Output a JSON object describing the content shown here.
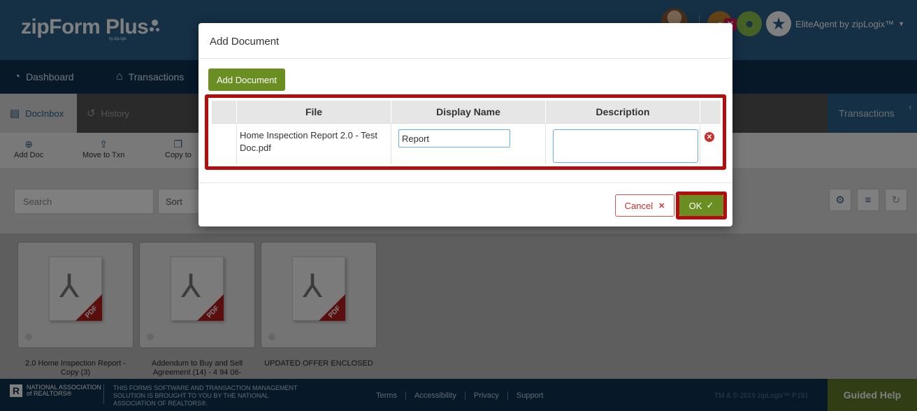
{
  "app": {
    "logo": "zipForm Plus",
    "logo_by": "by zipLogix",
    "user_name": "EliteAgent by zipLogix™"
  },
  "nav": {
    "dashboard": "Dashboard",
    "transactions": "Transactions"
  },
  "tabs": {
    "docinbox": "DocInbox",
    "history": "History",
    "transactions": "Transactions"
  },
  "toolbar": {
    "add_doc": "Add Doc",
    "move_to_txn": "Move to Txn",
    "copy_to": "Copy to"
  },
  "search": {
    "placeholder": "Search",
    "sort": "Sort"
  },
  "docs": [
    {
      "label": "2.0 Home Inspection Report - Copy (3)"
    },
    {
      "label": "Addendum to Buy and Sell Agreement (14) - 4 94 06-"
    },
    {
      "label": "UPDATED OFFER ENCLOSED"
    }
  ],
  "modal": {
    "title": "Add Document",
    "add_button": "Add Document",
    "columns": {
      "file": "File",
      "display_name": "Display Name",
      "description": "Description"
    },
    "row": {
      "file": "Home Inspection Report 2.0 - Test Doc.pdf",
      "display_name": "Report",
      "description": ""
    },
    "cancel": "Cancel",
    "ok": "OK"
  },
  "footer": {
    "nar": "NATIONAL ASSOCIATION of REALTORS®",
    "message": "THIS FORMS SOFTWARE AND TRANSACTION MANAGEMENT SOLUTION IS BROUGHT TO YOU BY THE NATIONAL ASSOCIATION OF REALTORS®.",
    "links": [
      "Terms",
      "Accessibility",
      "Privacy",
      "Support"
    ],
    "copyright": "TM & © 2019 zipLogix™ P191",
    "guided_help": "Guided Help"
  },
  "colors": {
    "brand_blue": "#2a5f89",
    "nav_dark": "#0f3352",
    "action_green": "#6b8e23",
    "highlight_red": "#b40d0d"
  }
}
